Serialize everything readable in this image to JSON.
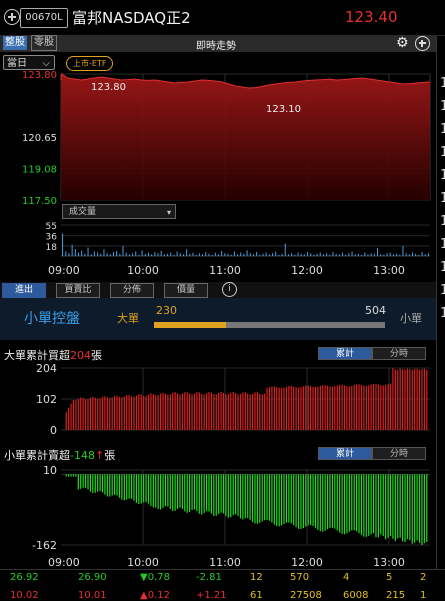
{
  "header": {
    "code": "00670L",
    "name": "富邦NASDAQ正2",
    "price": "123.40"
  },
  "tabs": {
    "main": "整股",
    "odd": "零股",
    "trend_title": "即時走勢"
  },
  "period_select": "當日",
  "etf_badge": "上市-ETF",
  "price_chart": {
    "y_ticks": [
      "123.80",
      "120.65",
      "119.08",
      "117.50"
    ],
    "high_label": "123.80",
    "low_label": "123.10",
    "ylim": [
      117.5,
      123.8
    ],
    "y_tick_values": [
      123.8,
      120.65,
      119.08,
      117.5
    ],
    "path": [
      [
        0,
        123.5
      ],
      [
        0.1,
        123.8
      ],
      [
        1,
        123.6
      ],
      [
        2,
        123.55
      ],
      [
        3,
        123.5
      ],
      [
        4,
        123.55
      ],
      [
        5,
        123.6
      ],
      [
        6,
        123.65
      ],
      [
        7,
        123.6
      ],
      [
        8,
        123.55
      ],
      [
        9,
        123.5
      ],
      [
        10,
        123.52
      ],
      [
        11,
        123.55
      ],
      [
        12,
        123.5
      ],
      [
        13,
        123.48
      ],
      [
        14,
        123.5
      ],
      [
        15,
        123.45
      ],
      [
        16,
        123.4
      ],
      [
        17,
        123.35
      ],
      [
        18,
        123.38
      ],
      [
        19,
        123.4
      ],
      [
        20,
        123.45
      ],
      [
        21,
        123.5
      ],
      [
        22,
        123.48
      ],
      [
        23,
        123.45
      ],
      [
        24,
        123.4
      ],
      [
        25,
        123.3
      ],
      [
        26,
        123.2
      ],
      [
        27,
        123.15
      ],
      [
        28,
        123.1
      ],
      [
        29,
        123.12
      ],
      [
        30,
        123.18
      ],
      [
        31,
        123.25
      ],
      [
        32,
        123.3
      ],
      [
        33,
        123.35
      ],
      [
        34,
        123.38
      ],
      [
        35,
        123.4
      ],
      [
        36,
        123.45
      ],
      [
        37,
        123.48
      ],
      [
        38,
        123.5
      ],
      [
        39,
        123.52
      ],
      [
        40,
        123.55
      ],
      [
        41,
        123.5
      ],
      [
        42,
        123.52
      ],
      [
        43,
        123.55
      ],
      [
        44,
        123.58
      ],
      [
        45,
        123.6
      ],
      [
        46,
        123.55
      ],
      [
        47,
        123.5
      ],
      [
        48,
        123.45
      ],
      [
        49,
        123.4
      ],
      [
        50,
        123.35
      ],
      [
        51,
        123.3
      ],
      [
        52,
        123.32
      ],
      [
        53,
        123.35
      ],
      [
        54,
        123.38
      ],
      [
        55,
        123.4
      ]
    ]
  },
  "volume": {
    "select_label": "成交量",
    "y_ticks": [
      "55",
      "36",
      "18"
    ],
    "ylim": [
      0,
      55
    ],
    "values": [
      40,
      8,
      5,
      20,
      12,
      6,
      10,
      4,
      15,
      3,
      8,
      6,
      4,
      12,
      5,
      3,
      7,
      9,
      4,
      18,
      6,
      3,
      5,
      8,
      2,
      10,
      4,
      6,
      3,
      7,
      5,
      9,
      3,
      4,
      6,
      2,
      8,
      5,
      3,
      12,
      4,
      6,
      2,
      5,
      3,
      7,
      4,
      2,
      6,
      3,
      9,
      5,
      4,
      2,
      8,
      3,
      6,
      4,
      10,
      5,
      3,
      7,
      2,
      4,
      6,
      3,
      5,
      8,
      2,
      4,
      22,
      3,
      5,
      2,
      6,
      4,
      3,
      7,
      5,
      2,
      4,
      6,
      3,
      5,
      2,
      7,
      4,
      3,
      6,
      2,
      5,
      8,
      3,
      4,
      2,
      6,
      3,
      5,
      4,
      14,
      3,
      2,
      5,
      6,
      3,
      4,
      2,
      18,
      5,
      3,
      6,
      4,
      2,
      7,
      3,
      5
    ]
  },
  "time_axis": [
    "09:00",
    "10:00",
    "11:00",
    "12:00",
    "13:00"
  ],
  "section_tabs": [
    "進出",
    "買賣比",
    "分佈",
    "價量"
  ],
  "control": {
    "title": "小單控盤",
    "big_label": "大單",
    "small_label": "小單",
    "big_value": "230",
    "small_value": "504",
    "big_fraction": 0.313
  },
  "big_panel": {
    "title_prefix": "大單累計買超",
    "title_value": "204",
    "title_suffix": "張",
    "seg_cum": "累計",
    "seg_time": "分時",
    "y_ticks": [
      "204",
      "102",
      "0"
    ],
    "ylim": [
      0,
      204
    ]
  },
  "small_panel": {
    "title_prefix": "小單累計賣超",
    "title_value": "-148",
    "title_suffix": "張",
    "seg_cum": "累計",
    "seg_time": "分時",
    "y_ticks": [
      "10",
      "-162"
    ],
    "ylim": [
      -162,
      10
    ]
  },
  "bottom_rows": [
    [
      "26.92",
      "26.90",
      "▼0.78",
      "-2.81",
      "12",
      "570",
      "4",
      "5",
      "2"
    ],
    [
      "10.02",
      "10.01",
      "▲0.12",
      "+1.21",
      "61",
      "27508",
      "6008",
      "215",
      "1"
    ]
  ],
  "right_edge_digits": [
    "1",
    "1",
    "1",
    "1",
    "1",
    "1",
    "1",
    "1",
    "1",
    "1",
    "1"
  ],
  "colors": {
    "up": "#e63030",
    "down": "#22cc22",
    "accent": "#3aa0e8",
    "orange": "#e0a020"
  }
}
